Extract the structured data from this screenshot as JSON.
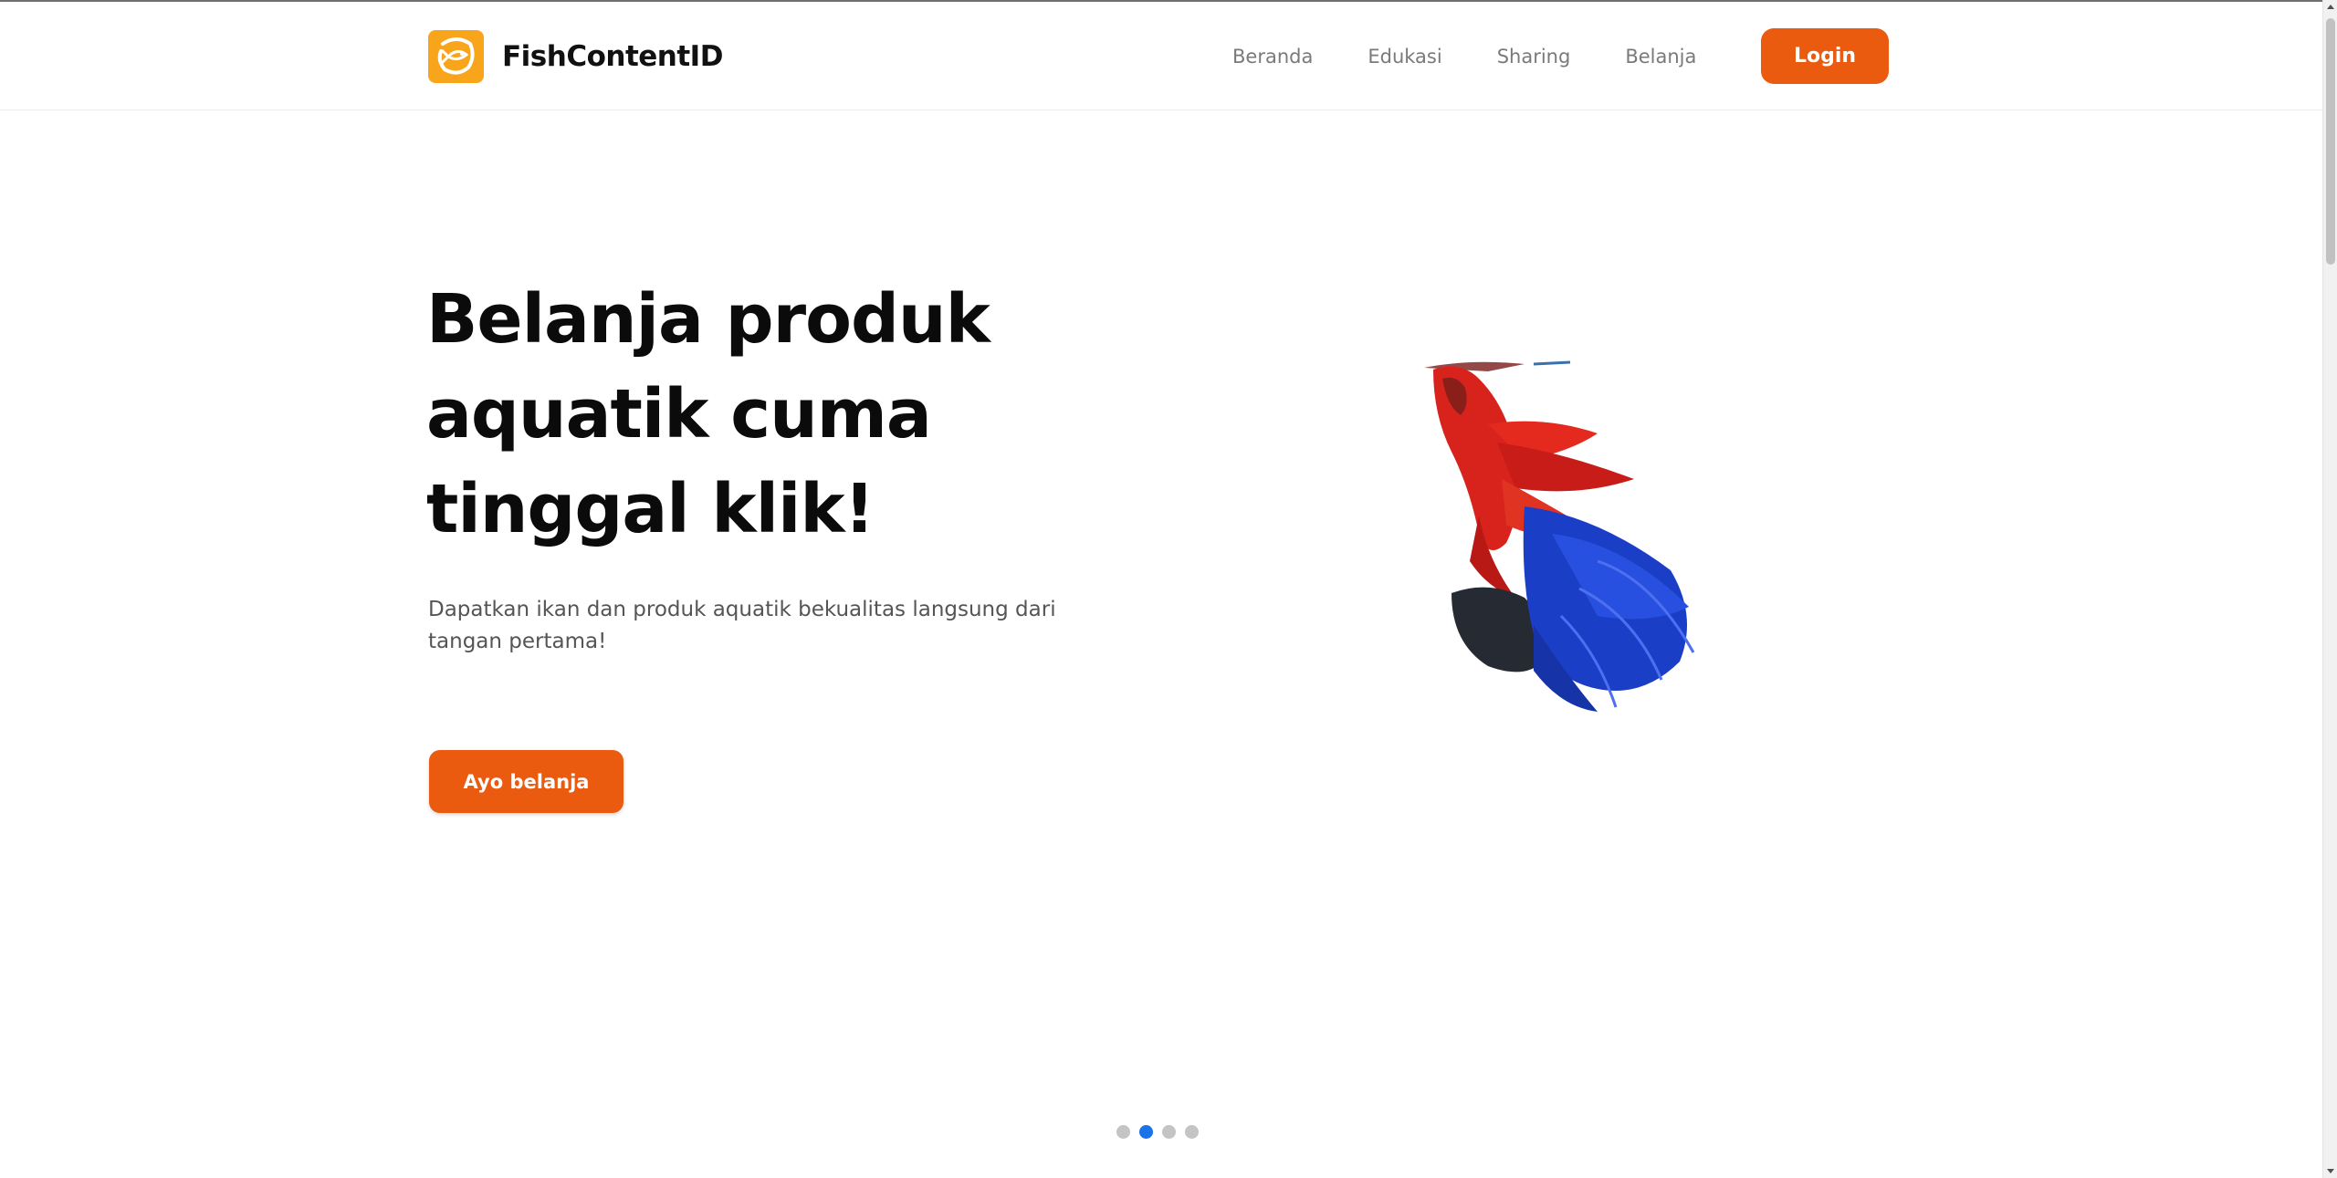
{
  "brand": {
    "name": "FishContentID",
    "logo_color": "#f9a51b"
  },
  "nav": {
    "items": [
      {
        "label": "Beranda"
      },
      {
        "label": "Edukasi"
      },
      {
        "label": "Sharing"
      },
      {
        "label": "Belanja"
      }
    ],
    "login_label": "Login"
  },
  "hero": {
    "title_lines": [
      "Belanja produk",
      "aquatik cuma",
      "tinggal klik!"
    ],
    "subtitle": "Dapatkan ikan dan produk aquatik bekualitas langsung dari tangan pertama!",
    "cta_label": "Ayo belanja",
    "image_icon": "betta-fish-image"
  },
  "carousel": {
    "slide_count": 4,
    "active_index": 1
  },
  "colors": {
    "accent": "#ea5a0f",
    "dot_active": "#1a73e8",
    "dot_inactive": "#c4c4c4"
  }
}
